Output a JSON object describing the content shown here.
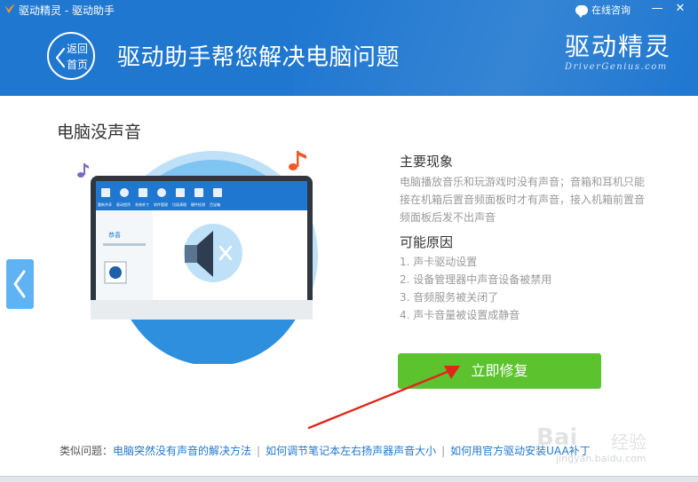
{
  "window": {
    "title": "驱动精灵 - 驱动助手",
    "consult_label": "在线咨询",
    "minimize": "—",
    "close": "✕"
  },
  "header": {
    "back_label": "返回首页",
    "headline": "驱动助手帮您解决电脑问题",
    "brand_cn": "驱动精灵",
    "brand_en": "DriverGenius.com"
  },
  "issue": {
    "title": "电脑没声音"
  },
  "symptoms": {
    "heading": "主要现象",
    "text": "电脑播放音乐和玩游戏时没有声音；音箱和耳机只能接在机箱后置音频面板时才有声音，接入机箱前置音频面板后发不出声音"
  },
  "causes": {
    "heading": "可能原因",
    "items": [
      "1. 声卡驱动设置",
      "2. 设备管理器中声音设备被禁用",
      "3. 音频服务被关闭了",
      "4. 声卡音量被设置成静音"
    ]
  },
  "fix_button": "立即修复",
  "related": {
    "label": "类似问题：",
    "links": [
      "电脑突然没有声音的解决方法",
      "如何调节笔记本左右扬声器声音大小",
      "如何用官方驱动安装UAA补丁"
    ]
  },
  "mini_screen": {
    "toolbar": [
      "重新共享",
      "驱动程序",
      "系统补丁",
      "软件管理",
      "垃圾清理",
      "硬件检测",
      "百宝箱"
    ],
    "left_title": "恭喜"
  },
  "watermark": {
    "text": "Bai",
    "text2": "经验",
    "url": "jingyan.baidu.com"
  },
  "colors": {
    "header": "#1f77d0",
    "fix": "#5cc22e",
    "link": "#1f77d0",
    "arrow": "#e0261b"
  },
  "icons": [
    "driver-genius-logo-icon",
    "chat-bubble-icon",
    "back-chevron-icon",
    "speaker-muted-icon",
    "music-note-icon",
    "prev-arrow-icon"
  ]
}
